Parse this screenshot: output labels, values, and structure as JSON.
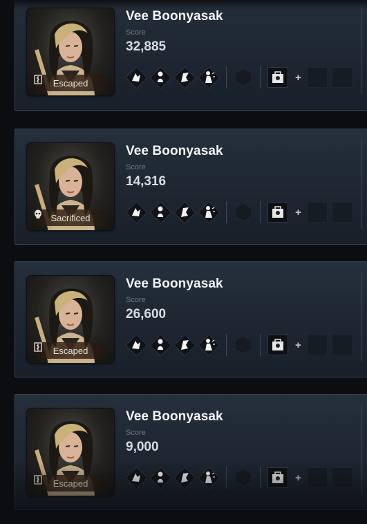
{
  "players": [
    {
      "name": "Vee Boonyasak",
      "score_label": "Score",
      "score": "32,885",
      "status": "Escaped",
      "status_icon": "door-icon"
    },
    {
      "name": "Vee Boonyasak",
      "score_label": "Score",
      "score": "14,316",
      "status": "Sacrificed",
      "status_icon": "skull-icon"
    },
    {
      "name": "Vee Boonyasak",
      "score_label": "Score",
      "score": "26,600",
      "status": "Escaped",
      "status_icon": "door-icon"
    },
    {
      "name": "Vee Boonyasak",
      "score_label": "Score",
      "score": "9,000",
      "status": "Escaped",
      "status_icon": "door-icon"
    }
  ],
  "loadout": {
    "perk_icons": [
      "hand-perk-icon",
      "figure-perk-icon",
      "claw-perk-icon",
      "crouch-perk-icon"
    ],
    "offering_icon": "hexagon-offering-icon",
    "item_icon": "toolbox-item-icon",
    "plus": "+"
  },
  "colors": {
    "card_bg": "#212a35",
    "card_border": "#3a4552",
    "page_bg": "#0b0d10",
    "name_text": "#f4f6f8",
    "label_text": "#6f7a86"
  }
}
